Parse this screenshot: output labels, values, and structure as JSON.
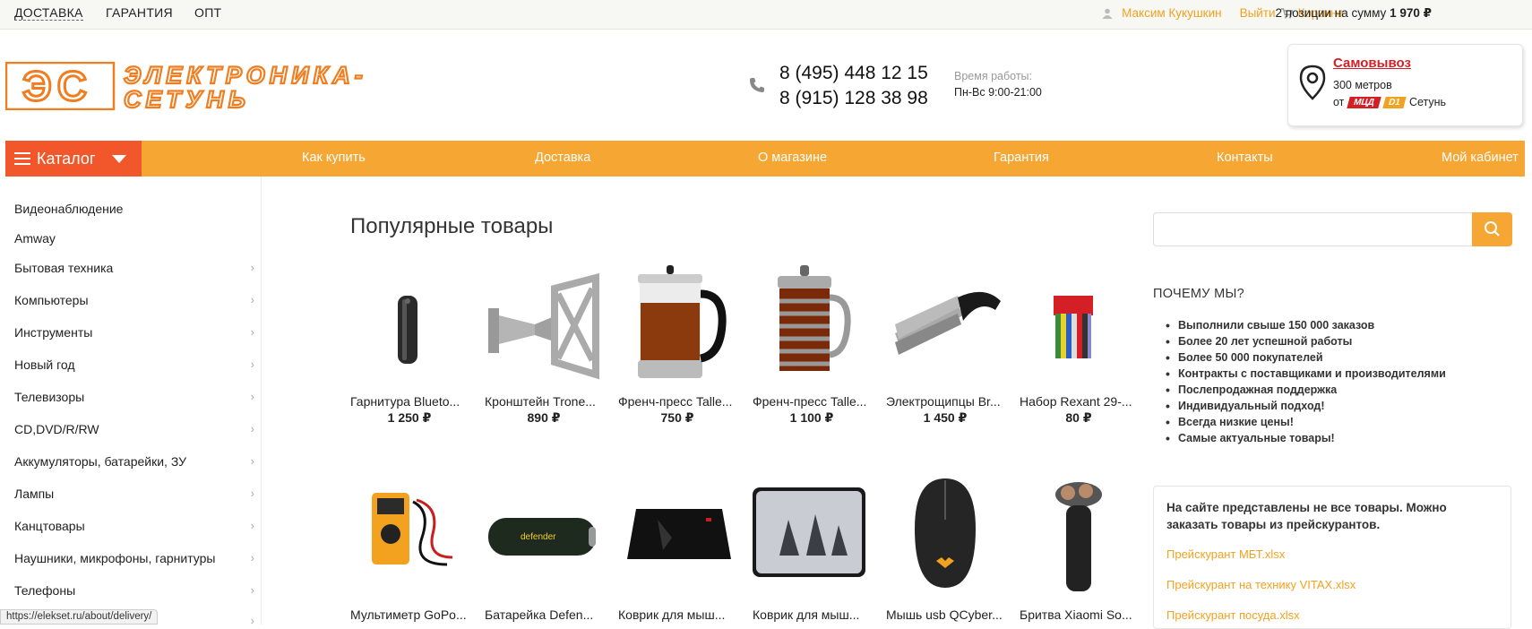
{
  "topbar": {
    "links": [
      "ДОСТАВКА",
      "ГАРАНТИЯ",
      "ОПТ"
    ],
    "user_name": "Максим Кукушкин",
    "logout": "Выйти",
    "cart": "Корзина",
    "cart_summary_prefix": "2 позиции на сумму",
    "cart_summary_total": "1 970 ₽"
  },
  "header": {
    "logo_line1": "ЭЛЕКТРОНИКА-",
    "logo_line2": "СЕТУНЬ",
    "logo_mark": "ЭС",
    "phone1": "8 (495) 448 12 15",
    "phone2": "8 (915) 128 38 98",
    "hours_label": "Время работы:",
    "hours_value": "Пн-Вс 9:00-21:00",
    "pickup_title": "Самовывоз",
    "pickup_distance": "300 метров",
    "pickup_from": "от",
    "pickup_badge1": "МЦД",
    "pickup_badge2": "D1",
    "pickup_station": "Сетунь"
  },
  "nav": {
    "catalog": "Каталог",
    "links": [
      "Как купить",
      "Доставка",
      "О магазине",
      "Гарантия",
      "Контакты",
      "Мой кабинет"
    ]
  },
  "sidebar": {
    "items": [
      {
        "label": "Видеонаблюдение",
        "has_sub": false
      },
      {
        "label": "Amway",
        "has_sub": false
      },
      {
        "label": "Бытовая техника",
        "has_sub": true
      },
      {
        "label": "Компьютеры",
        "has_sub": true
      },
      {
        "label": "Инструменты",
        "has_sub": true
      },
      {
        "label": "Новый год",
        "has_sub": true
      },
      {
        "label": "Телевизоры",
        "has_sub": true
      },
      {
        "label": "CD,DVD/R/RW",
        "has_sub": true
      },
      {
        "label": "Аккумуляторы, батарейки, ЗУ",
        "has_sub": true
      },
      {
        "label": "Лампы",
        "has_sub": true
      },
      {
        "label": "Канцтовары",
        "has_sub": true
      },
      {
        "label": "Наушники, микрофоны, гарнитуры",
        "has_sub": true
      },
      {
        "label": "Телефоны",
        "has_sub": true
      }
    ]
  },
  "main": {
    "title": "Популярные товары",
    "products_row1": [
      {
        "name": "Гарнитура Blueto...",
        "price": "1 250 ₽",
        "icon": "earbuds-image"
      },
      {
        "name": "Кронштейн Trone...",
        "price": "890 ₽",
        "icon": "tv-bracket-image"
      },
      {
        "name": "Френч-пресс Talle...",
        "price": "750 ₽",
        "icon": "french-press-image"
      },
      {
        "name": "Френч-пресс Talle...",
        "price": "1 100 ₽",
        "icon": "french-press-steel-image"
      },
      {
        "name": "Электрощипцы Br...",
        "price": "1 450 ₽",
        "icon": "hair-curler-image"
      },
      {
        "name": "Набор Rexant 29-...",
        "price": "80 ₽",
        "icon": "heat-shrink-set-image"
      }
    ],
    "products_row2": [
      {
        "name": "Мультиметр GoPo...",
        "icon": "multimeter-image"
      },
      {
        "name": "Батарейка Defen...",
        "icon": "battery-image"
      },
      {
        "name": "Коврик для мыш...",
        "icon": "mousepad-image"
      },
      {
        "name": "Коврик для мыш...",
        "icon": "mousepad-soldiers-image"
      },
      {
        "name": "Мышь usb QCyber...",
        "icon": "mouse-image"
      },
      {
        "name": "Бритва Xiaomi So...",
        "icon": "shaver-image"
      }
    ]
  },
  "right": {
    "search_placeholder": "",
    "why_title": "ПОЧЕМУ МЫ?",
    "why_items": [
      "Выполнили свыше 150 000 заказов",
      "Более 20 лет успешной работы",
      "Более 50 000 покупателей",
      "Контракты с поставщиками и производителями",
      "Послепродажная поддержка",
      "Индивидуальный подход!",
      "Всегда низкие цены!",
      "Самые актуальные товары!"
    ],
    "price_note": "На сайте представлены не все товары. Можно заказать товары из прейскурантов.",
    "price_links": [
      "Прейскурант МБТ.xlsx",
      "Прейскурант на технику VITAX.xlsx",
      "Прейскурант посуда.xlsx"
    ]
  },
  "status_url": "https://elekset.ru/about/delivery/",
  "colors": {
    "accent": "#f6a632",
    "catalog": "#f1572a",
    "red": "#d51f26"
  }
}
